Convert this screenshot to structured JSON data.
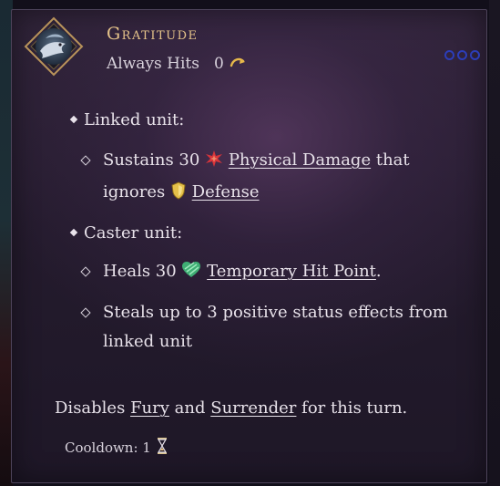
{
  "tooltip": {
    "title": "Gratitude",
    "subtitle": "Always Hits",
    "cost": "0",
    "emblem_icon": "dolphin-emblem-icon",
    "pips": 3,
    "lines": {
      "linked_unit": "Linked unit:",
      "sustains_prefix": "Sustains 30",
      "physical_damage": "Physical Damage",
      "that_ignores": "that ignores",
      "defense": "Defense",
      "caster_unit": "Caster unit:",
      "heals_prefix": "Heals 30",
      "temporary_hit_point": "Temporary Hit Point",
      "period": ".",
      "steals": "Steals up to 3 positive status effects from linked unit"
    },
    "footer": {
      "disables": "Disables",
      "fury": "Fury",
      "and": "and",
      "surrender": "Surrender",
      "for_this_turn": "for this turn."
    },
    "cooldown": "Cooldown: 1"
  },
  "colors": {
    "title": "#e6c48a",
    "pip": "#2c3db8",
    "damage": "#d8343a",
    "shield": "#e4c04a",
    "heal": "#3fae74"
  }
}
